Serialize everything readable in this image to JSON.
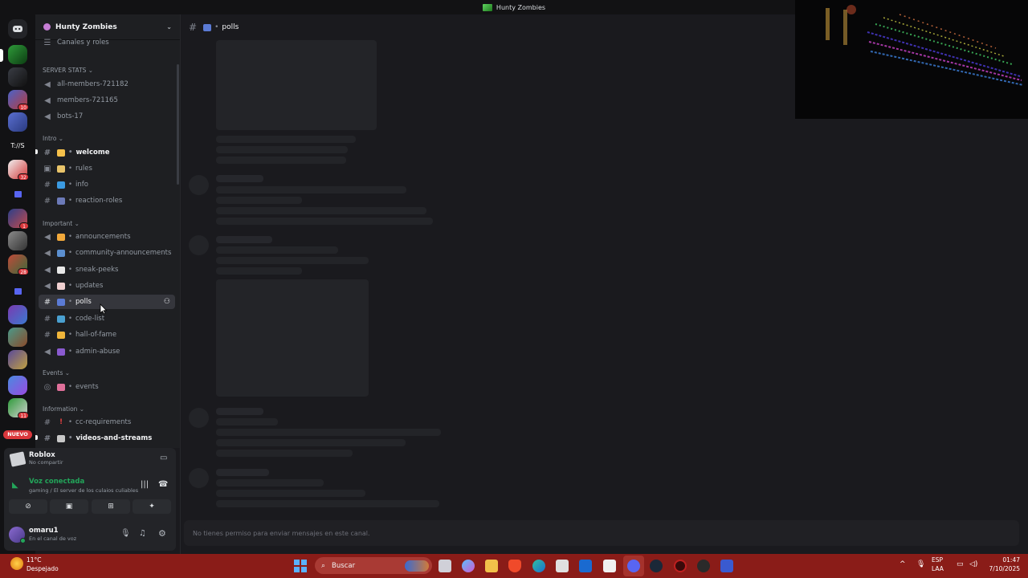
{
  "window": {
    "title": "Hunty Zombies"
  },
  "server": {
    "name": "Hunty Zombies",
    "channels_and_roles": "Canales y roles"
  },
  "categories": {
    "server_stats": "SERVER STATS",
    "intro": "Intro",
    "important": "Important",
    "events": "Events",
    "information": "Information"
  },
  "channels": {
    "all_members": "all-members-721182",
    "members": "members-721165",
    "bots": "bots-17",
    "welcome": "welcome",
    "rules": "rules",
    "info": "info",
    "reaction_roles": "reaction-roles",
    "announcements": "announcements",
    "community_announcements": "community-announcements",
    "sneak_peeks": "sneak-peeks",
    "updates": "updates",
    "polls": "polls",
    "code_list": "code-list",
    "hall_of_fame": "hall-of-fame",
    "admin_abuse": "admin-abuse",
    "events": "events",
    "cc_requirements": "cc-requirements",
    "videos_and_streams": "videos-and-streams"
  },
  "rail": {
    "new_label": "NUEVO",
    "badges": [
      "10",
      "32",
      "1",
      "28",
      "11"
    ]
  },
  "activity": {
    "game": "Roblox",
    "status": "No compartir"
  },
  "voice": {
    "status": "Voz conectada",
    "channel": "gaming / El server de los culaios culiables"
  },
  "user": {
    "name": "omaru1",
    "status": "En el canal de voz"
  },
  "main": {
    "channel_name": "polls",
    "no_permission": "No tienes permiso para enviar mensajes en este canal."
  },
  "taskbar": {
    "weather_temp": "11°C",
    "weather_desc": "Despejado",
    "search_placeholder": "Buscar",
    "lang_line1": "ESP",
    "lang_line2": "LAA",
    "time": "01:47",
    "date": "7/10/2025"
  },
  "colors": {
    "accent": "#5865f2",
    "voice_green": "#23a55a",
    "taskbar": "#8a1c18"
  }
}
